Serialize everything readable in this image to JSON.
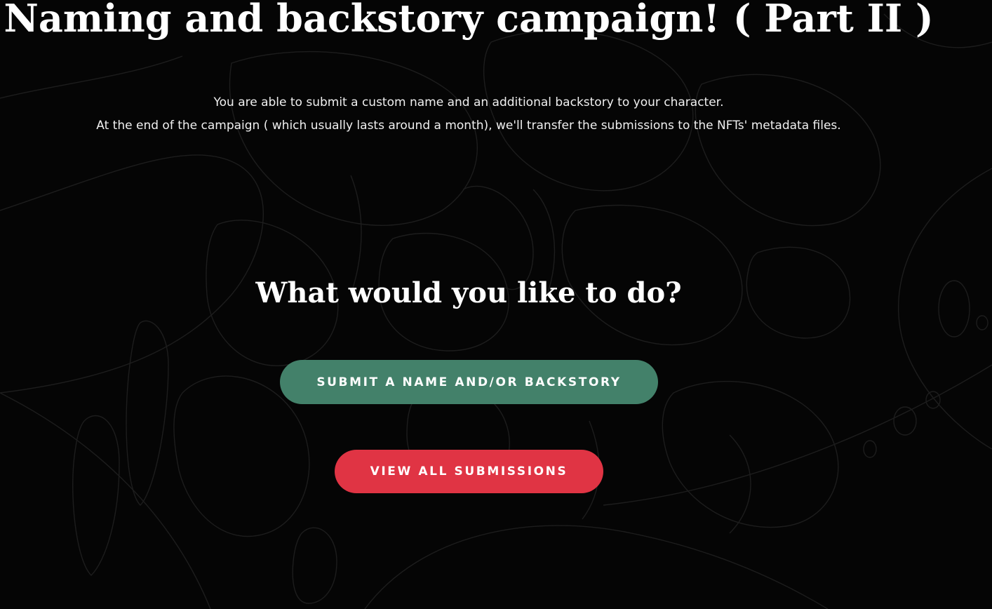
{
  "page": {
    "title": "Naming and backstory campaign! ( Part II )",
    "intro_line_1": "You are able to submit a custom name and an additional backstory to your character.",
    "intro_line_2": "At the end of the campaign ( which usually lasts around a month), we'll transfer the submissions to the NFTs' metadata files.",
    "question": "What would you like to do?"
  },
  "actions": {
    "submit_label": "SUBMIT A NAME AND/OR BACKSTORY",
    "view_label": "VIEW ALL SUBMISSIONS"
  },
  "colors": {
    "background": "#050505",
    "submit_button": "#43816a",
    "view_button": "#e03444",
    "text": "#ffffff",
    "background_art_lines": "#1c1c1c"
  }
}
